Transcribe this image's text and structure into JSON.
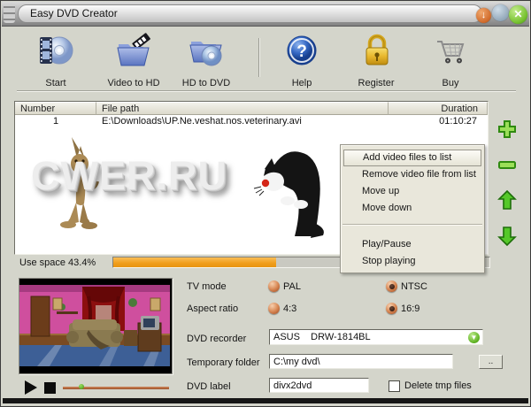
{
  "window": {
    "title": "Easy DVD Creator"
  },
  "toolbar": {
    "items": [
      {
        "label": "Start",
        "icon": "film-disc-icon"
      },
      {
        "label": "Video to HD",
        "icon": "folder-film-icon"
      },
      {
        "label": "HD to DVD",
        "icon": "folder-disc-icon"
      },
      {
        "label": "Help",
        "icon": "question-icon"
      },
      {
        "label": "Register",
        "icon": "padlock-icon"
      },
      {
        "label": "Buy",
        "icon": "cart-icon"
      }
    ]
  },
  "file_list": {
    "columns": [
      "Number",
      "File path",
      "Duration"
    ],
    "rows": [
      {
        "number": "1",
        "file_path": "E:\\Downloads\\UP.Ne.veshat.nos.veterinary.avi",
        "duration": "01:10:27"
      }
    ],
    "watermark": "CWER.RU"
  },
  "usage": {
    "label": "Use space 43.4%",
    "percent": 43.4
  },
  "context_menu": {
    "items": [
      "Add video files to list",
      "Remove video file from list",
      "Move up",
      "Move down",
      "Play/Pause",
      "Stop playing"
    ]
  },
  "settings": {
    "tv_mode_label": "TV mode",
    "pal_label": "PAL",
    "ntsc_label": "NTSC",
    "pal_selected": false,
    "ntsc_selected": true,
    "aspect_label": "Aspect ratio",
    "a43_label": "4:3",
    "a169_label": "16:9",
    "a43_selected": false,
    "a169_selected": true,
    "recorder_label": "DVD recorder",
    "recorder_value": "ASUS    DRW-1814BL",
    "temp_label": "Temporary folder",
    "temp_value": "C:\\my dvd\\",
    "browse_label": "..",
    "dvd_label_label": "DVD label",
    "dvd_label_value": "divx2dvd",
    "delete_tmp_label": "Delete tmp files",
    "delete_tmp_checked": false
  },
  "colors": {
    "accent_green": "#4aa51e",
    "progress_orange": "#f09d1b",
    "radio_copper": "#c4693c",
    "window_bg": "#d4d5cb"
  }
}
